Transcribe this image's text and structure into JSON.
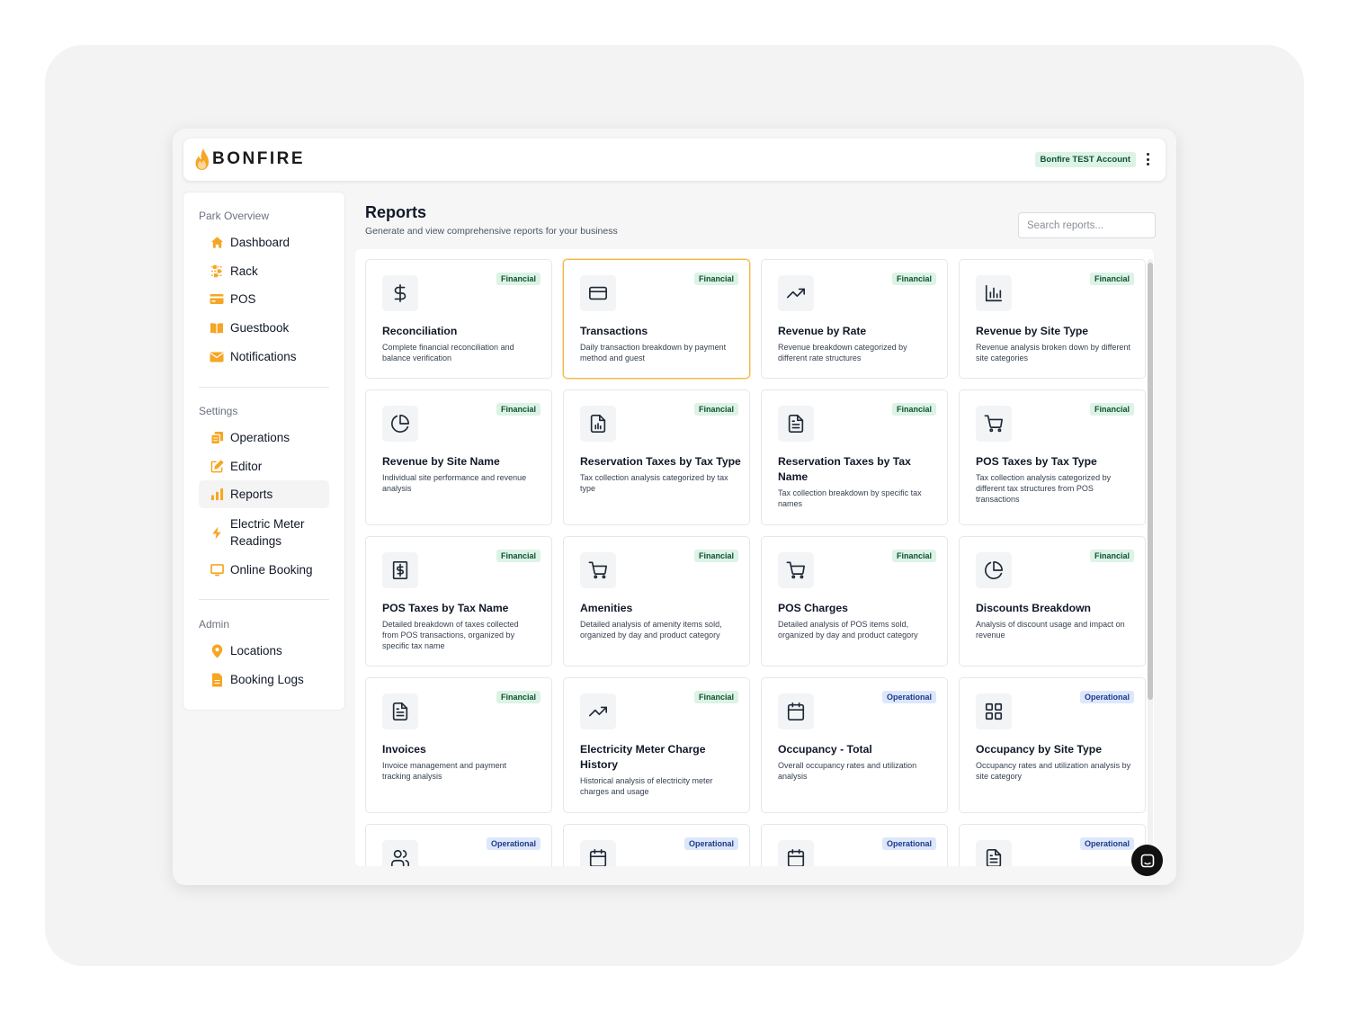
{
  "app": {
    "logo_text": "BONFIRE",
    "account_badge": "Bonfire TEST Account"
  },
  "sidebar": {
    "sections": [
      {
        "title": "Park Overview",
        "items": [
          {
            "label": "Dashboard",
            "icon": "home-icon"
          },
          {
            "label": "Rack",
            "icon": "sliders-icon"
          },
          {
            "label": "POS",
            "icon": "credit-card-icon"
          },
          {
            "label": "Guestbook",
            "icon": "book-icon"
          },
          {
            "label": "Notifications",
            "icon": "mail-icon"
          }
        ]
      },
      {
        "title": "Settings",
        "items": [
          {
            "label": "Operations",
            "icon": "documents-icon"
          },
          {
            "label": "Editor",
            "icon": "edit-icon"
          },
          {
            "label": "Reports",
            "icon": "bar-chart-icon",
            "active": true
          },
          {
            "label": "Electric Meter Readings",
            "icon": "lightning-icon"
          },
          {
            "label": "Online Booking",
            "icon": "monitor-icon"
          }
        ]
      },
      {
        "title": "Admin",
        "items": [
          {
            "label": "Locations",
            "icon": "map-pin-icon"
          },
          {
            "label": "Booking Logs",
            "icon": "file-icon"
          }
        ]
      }
    ]
  },
  "main": {
    "title": "Reports",
    "subtitle": "Generate and view comprehensive reports for your business",
    "search_placeholder": "Search reports..."
  },
  "reports": [
    {
      "title": "Reconciliation",
      "desc": "Complete financial reconciliation and balance verification",
      "tag": "Financial",
      "icon": "dollar-icon"
    },
    {
      "title": "Transactions",
      "desc": "Daily transaction breakdown by payment method and guest",
      "tag": "Financial",
      "icon": "credit-card-icon",
      "selected": true
    },
    {
      "title": "Revenue by Rate",
      "desc": "Revenue breakdown categorized by different rate structures",
      "tag": "Financial",
      "icon": "trending-up-icon"
    },
    {
      "title": "Revenue by Site Type",
      "desc": "Revenue analysis broken down by different site categories",
      "tag": "Financial",
      "icon": "bar-chart-icon"
    },
    {
      "title": "Revenue by Site Name",
      "desc": "Individual site performance and revenue analysis",
      "tag": "Financial",
      "icon": "pie-chart-icon"
    },
    {
      "title": "Reservation Taxes by Tax Type",
      "desc": "Tax collection analysis categorized by tax type",
      "tag": "Financial",
      "icon": "file-chart-icon"
    },
    {
      "title": "Reservation Taxes by Tax Name",
      "desc": "Tax collection breakdown by specific tax names",
      "tag": "Financial",
      "icon": "file-text-icon"
    },
    {
      "title": "POS Taxes by Tax Type",
      "desc": "Tax collection analysis categorized by different tax structures from POS transactions",
      "tag": "Financial",
      "icon": "cart-icon"
    },
    {
      "title": "POS Taxes by Tax Name",
      "desc": "Detailed breakdown of taxes collected from POS transactions, organized by specific tax name",
      "tag": "Financial",
      "icon": "receipt-icon"
    },
    {
      "title": "Amenities",
      "desc": "Detailed analysis of amenity items sold, organized by day and product category",
      "tag": "Financial",
      "icon": "cart-icon"
    },
    {
      "title": "POS Charges",
      "desc": "Detailed analysis of POS items sold, organized by day and product category",
      "tag": "Financial",
      "icon": "cart-icon"
    },
    {
      "title": "Discounts Breakdown",
      "desc": "Analysis of discount usage and impact on revenue",
      "tag": "Financial",
      "icon": "pie-chart-icon"
    },
    {
      "title": "Invoices",
      "desc": "Invoice management and payment tracking analysis",
      "tag": "Financial",
      "icon": "file-text-icon"
    },
    {
      "title": "Electricity Meter Charge History",
      "desc": "Historical analysis of electricity meter charges and usage",
      "tag": "Financial",
      "icon": "trending-up-icon"
    },
    {
      "title": "Occupancy - Total",
      "desc": "Overall occupancy rates and utilization analysis",
      "tag": "Operational",
      "icon": "calendar-icon"
    },
    {
      "title": "Occupancy by Site Type",
      "desc": "Occupancy rates and utilization analysis by site category",
      "tag": "Operational",
      "icon": "grid-icon"
    },
    {
      "title": "",
      "desc": "",
      "tag": "Operational",
      "icon": "users-icon"
    },
    {
      "title": "",
      "desc": "",
      "tag": "Operational",
      "icon": "calendar-icon"
    },
    {
      "title": "",
      "desc": "",
      "tag": "Operational",
      "icon": "calendar-icon"
    },
    {
      "title": "",
      "desc": "",
      "tag": "Operational",
      "icon": "file-text-icon"
    }
  ]
}
